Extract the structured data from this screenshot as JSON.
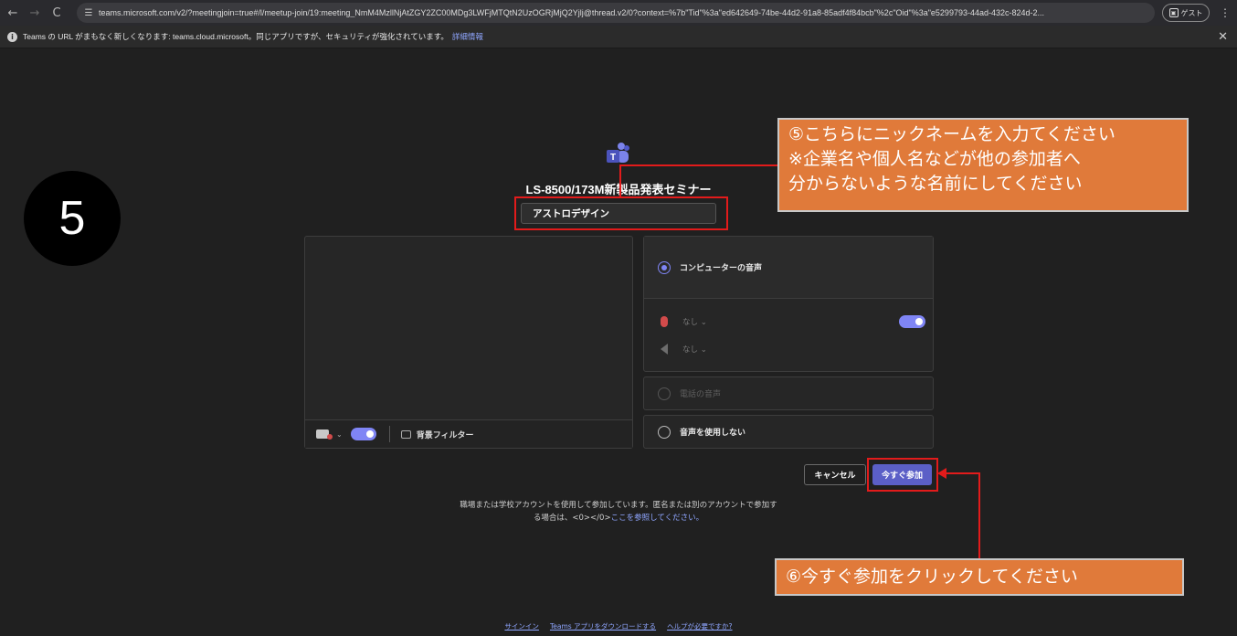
{
  "browser": {
    "url": "teams.microsoft.com/v2/?meetingjoin=true#/l/meetup-join/19:meeting_NmM4MzllNjAtZGY2ZC00MDg3LWFjMTQtN2UzOGRjMjQ2Yjlj@thread.v2/0?context=%7b\"Tid\"%3a\"ed642649-74be-44d2-91a8-85adf4f84bcb\"%2c\"Oid\"%3a\"e5299793-44ad-432c-824d-2...",
    "guest_label": "ゲスト",
    "back_icon": "←",
    "forward_icon": "→",
    "reload_icon": "C",
    "menu_icon": "⋮"
  },
  "infobar": {
    "message": "Teams の URL がまもなく新しくなります: teams.cloud.microsoft。同じアプリですが、セキュリティが強化されています。",
    "link": "詳細情報",
    "close_icon": "✕"
  },
  "step_number": "5",
  "meeting": {
    "title": "LS-8500/173M新製品発表セミナー",
    "name_value": "アストロデザイン"
  },
  "video": {
    "background_filter_label": "背景フィルター",
    "chevron": "⌄"
  },
  "audio": {
    "computer_audio_label": "コンピューターの音声",
    "mic_device": "なし ⌄",
    "speaker_device": "なし ⌄",
    "phone_audio_label": "電話の音声",
    "no_audio_label": "音声を使用しない"
  },
  "actions": {
    "cancel_label": "キャンセル",
    "join_label": "今すぐ参加"
  },
  "account_note": {
    "text_line1": "職場または学校アカウントを使用して参加しています。匿名または別のアカウントで参加す",
    "text_line2": "る場合は、<0></0>",
    "link": "ここを参照してください。"
  },
  "footer": {
    "signin": "サインイン",
    "download": "Teams アプリをダウンロードする",
    "help": "ヘルプが必要ですか?"
  },
  "annotations": {
    "callout1_line1": "⑤こちらにニックネームを入力てください",
    "callout1_line2": "※企業名や個人名などが他の参加者へ",
    "callout1_line3": "分からないような名前にしてください",
    "callout2": "⑥今すぐ参加をクリックしてください"
  },
  "colors": {
    "accent": "#5b5fc7",
    "toggle": "#7f85f5",
    "annotation_fill": "#e07a3a",
    "highlight_red": "#e21b1b",
    "background": "#202020"
  }
}
